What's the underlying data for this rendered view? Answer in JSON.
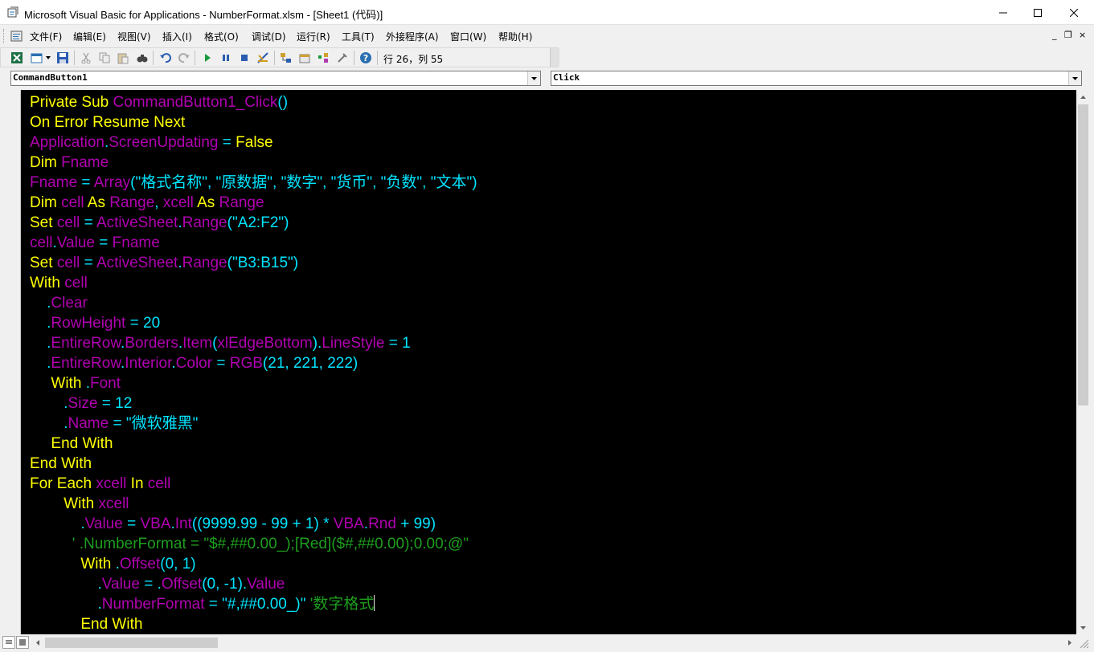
{
  "window": {
    "title": "Microsoft Visual Basic for Applications - NumberFormat.xlsm - [Sheet1 (代码)]",
    "controls": {
      "minimize": "minimize-icon",
      "maximize": "maximize-icon",
      "close": "close-icon"
    }
  },
  "menubar": {
    "items": [
      {
        "label": "文件(F)"
      },
      {
        "label": "编辑(E)"
      },
      {
        "label": "视图(V)"
      },
      {
        "label": "插入(I)"
      },
      {
        "label": "格式(O)"
      },
      {
        "label": "调试(D)"
      },
      {
        "label": "运行(R)"
      },
      {
        "label": "工具(T)"
      },
      {
        "label": "外接程序(A)"
      },
      {
        "label": "窗口(W)"
      },
      {
        "label": "帮助(H)"
      }
    ],
    "mdi": {
      "minimize": "_",
      "restore": "❐",
      "close": "×"
    }
  },
  "toolbar": {
    "icons": [
      "excel-icon",
      "insert-userform-icon",
      "save-icon",
      "cut-icon",
      "copy-icon",
      "paste-icon",
      "find-icon",
      "undo-icon",
      "redo-icon",
      "run-icon",
      "break-icon",
      "reset-icon",
      "design-mode-icon",
      "project-explorer-icon",
      "properties-icon",
      "object-browser-icon",
      "toolbox-icon",
      "help-icon"
    ],
    "position": "行 26，列 55"
  },
  "combos": {
    "object": "CommandButton1",
    "procedure": "Click"
  },
  "colors": {
    "keyword": "#ffff00",
    "identifier": "#b000b0",
    "text": "#00e5ff",
    "comment": "#1e9e1e",
    "background": "#000000"
  },
  "code": {
    "lines": [
      [
        [
          "kw",
          "Private Sub "
        ],
        [
          "id",
          "CommandButton1_Click"
        ],
        [
          "tx",
          "()"
        ]
      ],
      [
        [
          "kw",
          "On Error Resume Next"
        ]
      ],
      [
        [
          "id",
          "Application"
        ],
        [
          "tx",
          "."
        ],
        [
          "id",
          "ScreenUpdating"
        ],
        [
          "tx",
          " = "
        ],
        [
          "kw",
          "False"
        ]
      ],
      [
        [
          "kw",
          "Dim "
        ],
        [
          "id",
          "Fname"
        ]
      ],
      [
        [
          "id",
          "Fname"
        ],
        [
          "tx",
          " = "
        ],
        [
          "id",
          "Array"
        ],
        [
          "tx",
          "(\"格式名称\", \"原数据\", \"数字\", \"货币\", \"负数\", \"文本\")"
        ]
      ],
      [
        [
          "kw",
          "Dim "
        ],
        [
          "id",
          "cell"
        ],
        [
          "kw",
          " As "
        ],
        [
          "id",
          "Range"
        ],
        [
          "tx",
          ", "
        ],
        [
          "id",
          "xcell"
        ],
        [
          "kw",
          " As "
        ],
        [
          "id",
          "Range"
        ]
      ],
      [
        [
          "kw",
          "Set "
        ],
        [
          "id",
          "cell"
        ],
        [
          "tx",
          " = "
        ],
        [
          "id",
          "ActiveSheet"
        ],
        [
          "tx",
          "."
        ],
        [
          "id",
          "Range"
        ],
        [
          "tx",
          "(\"A2:F2\")"
        ]
      ],
      [
        [
          "id",
          "cell"
        ],
        [
          "tx",
          "."
        ],
        [
          "id",
          "Value"
        ],
        [
          "tx",
          " = "
        ],
        [
          "id",
          "Fname"
        ]
      ],
      [
        [
          "kw",
          "Set "
        ],
        [
          "id",
          "cell"
        ],
        [
          "tx",
          " = "
        ],
        [
          "id",
          "ActiveSheet"
        ],
        [
          "tx",
          "."
        ],
        [
          "id",
          "Range"
        ],
        [
          "tx",
          "(\"B3:B15\")"
        ]
      ],
      [
        [
          "kw",
          "With "
        ],
        [
          "id",
          "cell"
        ]
      ],
      [
        [
          "tx",
          "    ."
        ],
        [
          "id",
          "Clear"
        ]
      ],
      [
        [
          "tx",
          "    ."
        ],
        [
          "id",
          "RowHeight"
        ],
        [
          "tx",
          " = 20"
        ]
      ],
      [
        [
          "tx",
          "    ."
        ],
        [
          "id",
          "EntireRow"
        ],
        [
          "tx",
          "."
        ],
        [
          "id",
          "Borders"
        ],
        [
          "tx",
          "."
        ],
        [
          "id",
          "Item"
        ],
        [
          "tx",
          "("
        ],
        [
          "id",
          "xlEdgeBottom"
        ],
        [
          "tx",
          ")."
        ],
        [
          "id",
          "LineStyle"
        ],
        [
          "tx",
          " = 1"
        ]
      ],
      [
        [
          "tx",
          "    ."
        ],
        [
          "id",
          "EntireRow"
        ],
        [
          "tx",
          "."
        ],
        [
          "id",
          "Interior"
        ],
        [
          "tx",
          "."
        ],
        [
          "id",
          "Color"
        ],
        [
          "tx",
          " = "
        ],
        [
          "id",
          "RGB"
        ],
        [
          "tx",
          "(21, 221, 222)"
        ]
      ],
      [
        [
          "kw",
          "     With "
        ],
        [
          "tx",
          "."
        ],
        [
          "id",
          "Font"
        ]
      ],
      [
        [
          "tx",
          "        ."
        ],
        [
          "id",
          "Size"
        ],
        [
          "tx",
          " = 12"
        ]
      ],
      [
        [
          "tx",
          "        ."
        ],
        [
          "id",
          "Name"
        ],
        [
          "tx",
          " = \"微软雅黑\""
        ]
      ],
      [
        [
          "kw",
          "     End With"
        ]
      ],
      [
        [
          "kw",
          "End With"
        ]
      ],
      [
        [
          "kw",
          "For Each "
        ],
        [
          "id",
          "xcell"
        ],
        [
          "kw",
          " In "
        ],
        [
          "id",
          "cell"
        ]
      ],
      [
        [
          "kw",
          "        With "
        ],
        [
          "id",
          "xcell"
        ]
      ],
      [
        [
          "tx",
          "            ."
        ],
        [
          "id",
          "Value"
        ],
        [
          "tx",
          " = "
        ],
        [
          "id",
          "VBA"
        ],
        [
          "tx",
          "."
        ],
        [
          "id",
          "Int"
        ],
        [
          "tx",
          "((9999.99 - 99 + 1) * "
        ],
        [
          "id",
          "VBA"
        ],
        [
          "tx",
          "."
        ],
        [
          "id",
          "Rnd"
        ],
        [
          "tx",
          " + 99)"
        ]
      ],
      [
        [
          "cm",
          "          ' .NumberFormat = \"$#,##0.00_);[Red]($#,##0.00);0.00;@\""
        ]
      ],
      [
        [
          "kw",
          "            With "
        ],
        [
          "tx",
          "."
        ],
        [
          "id",
          "Offset"
        ],
        [
          "tx",
          "(0, 1)"
        ]
      ],
      [
        [
          "tx",
          "                ."
        ],
        [
          "id",
          "Value"
        ],
        [
          "tx",
          " = ."
        ],
        [
          "id",
          "Offset"
        ],
        [
          "tx",
          "(0, -1)."
        ],
        [
          "id",
          "Value"
        ]
      ],
      [
        [
          "tx",
          "                ."
        ],
        [
          "id",
          "NumberFormat"
        ],
        [
          "tx",
          " = \"#,##0.00_)\" "
        ],
        [
          "cm",
          "'数字格式"
        ]
      ],
      [
        [
          "kw",
          "            End With"
        ]
      ]
    ]
  }
}
